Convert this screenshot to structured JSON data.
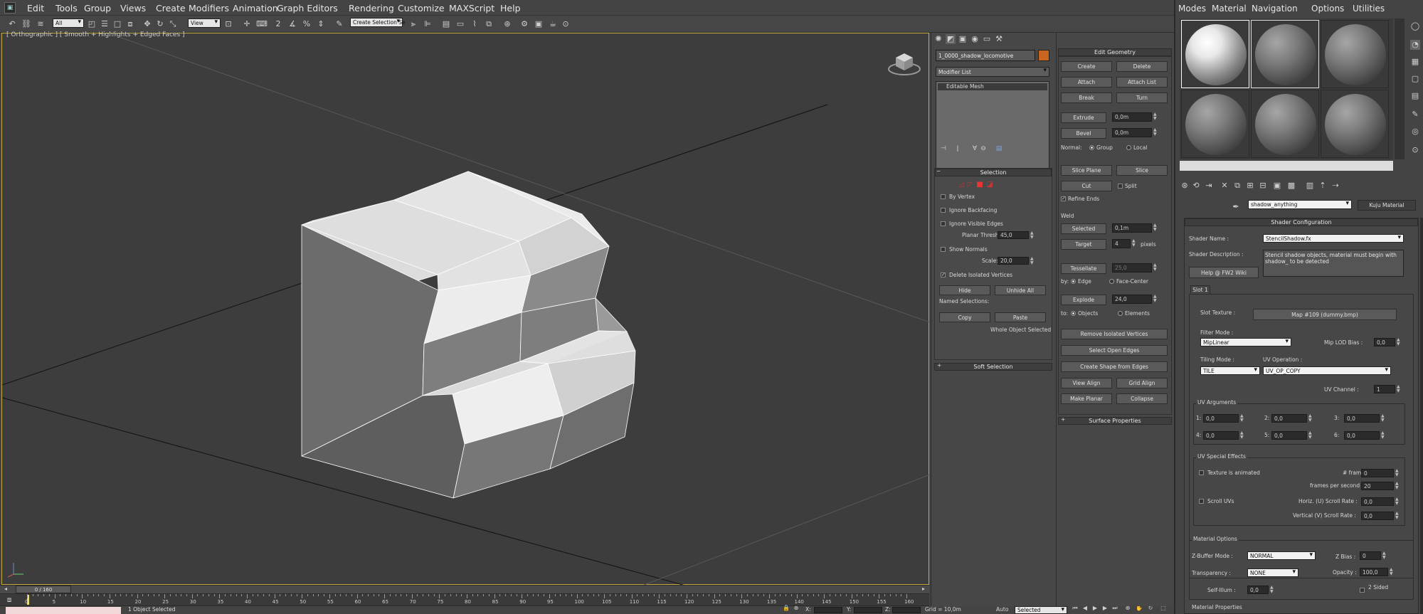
{
  "menubar": {
    "items": [
      "Edit",
      "Tools",
      "Group",
      "Views",
      "Create",
      "Modifiers",
      "Animation",
      "Graph Editors",
      "Rendering",
      "Customize",
      "MAXScript",
      "Help"
    ]
  },
  "toolbar": {
    "filter": "All",
    "ref_coord": "View",
    "selection_set": "Create Selection Se"
  },
  "viewport": {
    "label": "[ Orthographic ] [ Smooth + Highlights + Edged Faces ]",
    "frame_counter": "0 / 160"
  },
  "timeline": {
    "ticks": [
      "0",
      "5",
      "10",
      "15",
      "20",
      "25",
      "30",
      "35",
      "40",
      "45",
      "50",
      "55",
      "60",
      "65",
      "70",
      "75",
      "80",
      "85",
      "90",
      "95",
      "100",
      "105",
      "110",
      "115",
      "120",
      "125",
      "130",
      "135",
      "140",
      "145",
      "150",
      "155",
      "160"
    ]
  },
  "status": {
    "selected_text": "1 Object Selected",
    "x_label": "X:",
    "y_label": "Y:",
    "z_label": "Z:",
    "grid": "Grid = 10,0m",
    "auto": "Auto",
    "key_filter": "Selected"
  },
  "command_panel": {
    "object_name": "1_0000_shadow_locomotive",
    "object_color": "#c8651e",
    "modifier_list": "Modifier List",
    "stack_item": "Editable Mesh",
    "selection": {
      "title": "Selection",
      "by_vertex": "By Vertex",
      "ignore_backfacing": "Ignore Backfacing",
      "ignore_visible_edges": "Ignore Visible Edges",
      "planar_thresh_label": "Planar Thresh:",
      "planar_thresh": "45,0",
      "show_normals": "Show Normals",
      "scale_label": "Scale:",
      "scale": "20,0",
      "delete_isolated": "Delete Isolated Vertices",
      "hide": "Hide",
      "unhide_all": "Unhide All",
      "named_selections": "Named Selections:",
      "copy": "Copy",
      "paste": "Paste",
      "whole_object": "Whole Object Selected"
    },
    "soft_selection": "Soft Selection"
  },
  "edit_geometry": {
    "title": "Edit Geometry",
    "create": "Create",
    "delete": "Delete",
    "attach": "Attach",
    "attach_list": "Attach List",
    "break": "Break",
    "turn": "Turn",
    "extrude": "Extrude",
    "extrude_val": "0,0m",
    "bevel": "Bevel",
    "bevel_val": "0,0m",
    "normal_label": "Normal:",
    "group": "Group",
    "local": "Local",
    "slice_plane": "Slice Plane",
    "slice": "Slice",
    "cut": "Cut",
    "split": "Split",
    "refine_ends": "Refine Ends",
    "weld": "Weld",
    "selected": "Selected",
    "selected_val": "0,1m",
    "target": "Target",
    "target_val": "4",
    "pixels": "pixels",
    "tessellate": "Tessellate",
    "tess_val": "25,0",
    "by_label": "by:",
    "edge": "Edge",
    "face_center": "Face-Center",
    "explode": "Explode",
    "explode_val": "24,0",
    "to_label": "to:",
    "objects": "Objects",
    "elements": "Elements",
    "remove_isolated": "Remove Isolated Vertices",
    "select_open_edges": "Select Open Edges",
    "create_shape": "Create Shape from Edges",
    "view_align": "View Align",
    "grid_align": "Grid Align",
    "make_planar": "Make Planar",
    "collapse": "Collapse",
    "surface_properties": "Surface Properties"
  },
  "material_editor": {
    "menu": [
      "Modes",
      "Material",
      "Navigation",
      "Options",
      "Utilities"
    ],
    "material_name": "shadow_anything",
    "material_type": "Kuju Material",
    "shader_config_title": "Shader Configuration",
    "shader_name_label": "Shader Name :",
    "shader_name": "StencilShadow.fx",
    "shader_desc_label": "Shader Description :",
    "shader_desc": "Stencil shadow objects, material must begin with shadow_ to be detected",
    "help_btn": "Help @ FW2 Wiki",
    "slot_tab": "Slot 1",
    "slot_texture_label": "Slot Texture :",
    "slot_texture": "Map #109 (dummy.bmp)",
    "filter_mode_label": "Filter Mode :",
    "filter_mode": "MipLinear",
    "mip_lod_label": "Mip LOD Bias :",
    "mip_lod": "0,0",
    "tiling_label": "Tiling Mode :",
    "tiling": "TILE",
    "uv_op_label": "UV Operation :",
    "uv_op": "UV_OP_COPY",
    "uv_channel_label": "UV Channel :",
    "uv_channel": "1",
    "uv_args_title": "UV Arguments",
    "uv_args": [
      {
        "label": "1:",
        "value": "0,0"
      },
      {
        "label": "2:",
        "value": "0,0"
      },
      {
        "label": "3:",
        "value": "0,0"
      },
      {
        "label": "4:",
        "value": "0,0"
      },
      {
        "label": "5:",
        "value": "0,0"
      },
      {
        "label": "6:",
        "value": "0,0"
      }
    ],
    "uv_special_title": "UV Special Effects",
    "texture_animated": "Texture is animated",
    "frames_label": "# frames :",
    "frames": "0",
    "fps_label": "frames per second :",
    "fps": "20",
    "scroll_uvs": "Scroll UVs",
    "horiz_label": "Horiz. (U) Scroll Rate :",
    "horiz": "0,0",
    "vert_label": "Vertical (V) Scroll Rate :",
    "vert": "0,0",
    "mat_options_title": "Material Options",
    "zbuffer_label": "Z-Buffer Mode :",
    "zbuffer": "NORMAL",
    "zbias_label": "Z Bias :",
    "zbias": "0",
    "transparency_label": "Transparency :",
    "transparency": "NONE",
    "opacity_label": "Opacity :",
    "opacity": "100,0",
    "selfillum_label": "Self-Illum :",
    "selfillum": "0,0",
    "two_sided": "2 Sided",
    "mat_properties_title": "Material Properties"
  }
}
